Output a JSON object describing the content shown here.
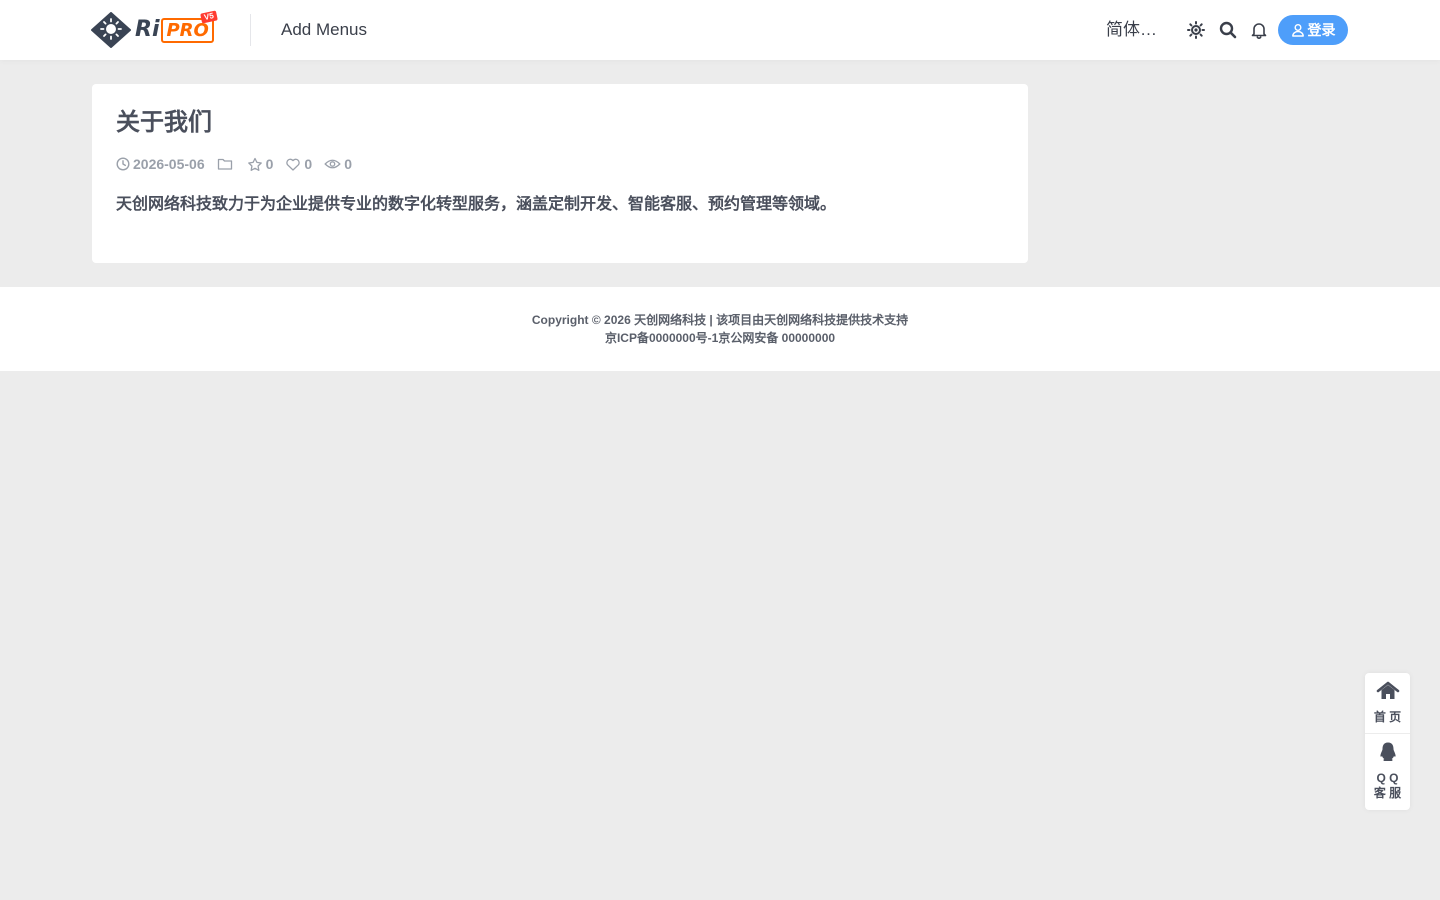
{
  "header": {
    "logo": {
      "brand_ri": "Ri",
      "brand_pro": "PRO",
      "badge": "V5"
    },
    "nav_label": "Add Menus",
    "lang_label": "简体…",
    "icons": [
      "theme-toggle-icon",
      "search-icon",
      "bell-icon",
      "user-icon"
    ],
    "login_label": "登录",
    "login_color": "#4e9efa",
    "pro_color": "#ff6a00"
  },
  "post": {
    "title": "关于我们",
    "date": "2026-05-06",
    "favorites": "0",
    "likes": "0",
    "views": "0",
    "body": "天创网络科技致力于为企业提供专业的数字化转型服务，涵盖定制开发、智能客服、预约管理等领域。"
  },
  "footer": {
    "line1": "Copyright © 2026 天创网络科技 | 该项目由天创网络科技提供技术支持",
    "line2": "京ICP备0000000号-1京公网安备 00000000"
  },
  "side_bar": {
    "home_label": "首 页",
    "qq_label_line1": "Q Q",
    "qq_label_line2": "客 服"
  }
}
